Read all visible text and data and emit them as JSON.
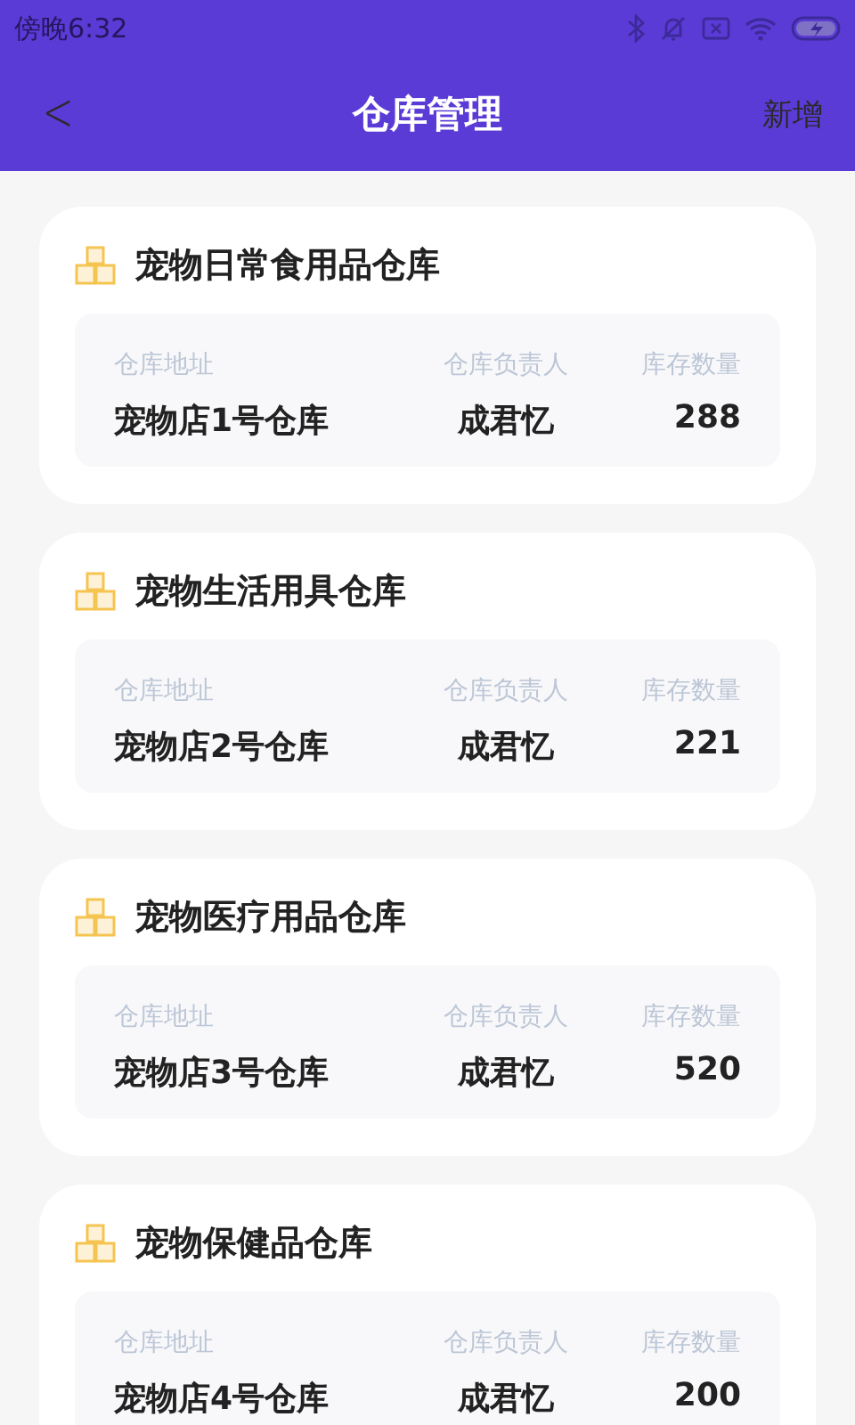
{
  "status_bar": {
    "time": "傍晚6:32"
  },
  "header": {
    "back": "<",
    "title": "仓库管理",
    "action": "新增"
  },
  "warehouses": [
    {
      "name": "宠物日常食用品仓库",
      "address_label": "仓库地址",
      "address": "宠物店1号仓库",
      "manager_label": "仓库负责人",
      "manager": "成君忆",
      "stock_label": "库存数量",
      "stock": "288"
    },
    {
      "name": "宠物生活用具仓库",
      "address_label": "仓库地址",
      "address": "宠物店2号仓库",
      "manager_label": "仓库负责人",
      "manager": "成君忆",
      "stock_label": "库存数量",
      "stock": "221"
    },
    {
      "name": "宠物医疗用品仓库",
      "address_label": "仓库地址",
      "address": "宠物店3号仓库",
      "manager_label": "仓库负责人",
      "manager": "成君忆",
      "stock_label": "库存数量",
      "stock": "520"
    },
    {
      "name": "宠物保健品仓库",
      "address_label": "仓库地址",
      "address": "宠物店4号仓库",
      "manager_label": "仓库负责人",
      "manager": "成君忆",
      "stock_label": "库存数量",
      "stock": "200"
    }
  ]
}
